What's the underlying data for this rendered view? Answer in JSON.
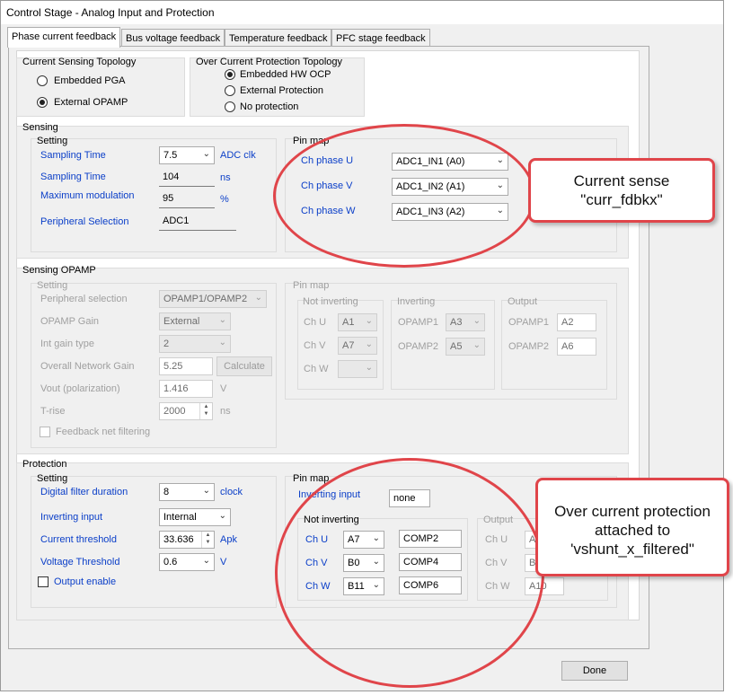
{
  "window": {
    "title": "Control Stage - Analog Input and Protection"
  },
  "tabs": [
    "Phase current feedback",
    "Bus voltage feedback",
    "Temperature feedback",
    "PFC stage feedback"
  ],
  "topology": {
    "label": "Current Sensing Topology",
    "options": [
      "Embedded PGA",
      "External OPAMP"
    ],
    "selected": "External OPAMP"
  },
  "ocp_topology": {
    "label": "Over Current Protection Topology",
    "options": [
      "Embedded HW OCP",
      "External Protection",
      "No protection"
    ],
    "selected": "Embedded HW OCP"
  },
  "sensing": {
    "label": "Sensing",
    "setting_label": "Setting",
    "sampling_time_1": {
      "label": "Sampling Time",
      "value": "7.5",
      "unit": "ADC clk"
    },
    "sampling_time_2": {
      "label": "Sampling Time",
      "value": "104",
      "unit": "ns"
    },
    "max_modulation": {
      "label": "Maximum modulation",
      "value": "95",
      "unit": "%"
    },
    "peripheral": {
      "label": "Peripheral Selection",
      "value": "ADC1"
    },
    "pinmap_label": "Pin map",
    "pins": [
      {
        "label": "Ch phase U",
        "value": "ADC1_IN1 (A0)"
      },
      {
        "label": "Ch phase V",
        "value": "ADC1_IN2 (A1)"
      },
      {
        "label": "Ch phase W",
        "value": "ADC1_IN3 (A2)"
      }
    ]
  },
  "sensing_opamp": {
    "label": "Sensing OPAMP",
    "setting_label": "Setting",
    "peripheral": {
      "label": "Peripheral selection",
      "value": "OPAMP1/OPAMP2"
    },
    "gain": {
      "label": "OPAMP Gain",
      "value": "External"
    },
    "int_gain": {
      "label": "Int gain type",
      "value": "2"
    },
    "network_gain": {
      "label": "Overall Network Gain",
      "value": "5.25",
      "button": "Calculate"
    },
    "vout": {
      "label": "Vout (polarization)",
      "value": "1.416",
      "unit": "V"
    },
    "trise": {
      "label": "T-rise",
      "value": "2000",
      "unit": "ns"
    },
    "feedback_filter": {
      "label": "Feedback net filtering"
    },
    "pinmap_label": "Pin map",
    "not_inverting_label": "Not inverting",
    "ni": [
      {
        "label": "Ch U",
        "value": "A1"
      },
      {
        "label": "Ch V",
        "value": "A7"
      },
      {
        "label": "Ch W",
        "value": ""
      }
    ],
    "inverting_label": "Inverting",
    "inv": [
      {
        "label": "OPAMP1",
        "value": "A3"
      },
      {
        "label": "OPAMP2",
        "value": "A5"
      }
    ],
    "output_label": "Output",
    "out": [
      {
        "label": "OPAMP1",
        "value": "A2"
      },
      {
        "label": "OPAMP2",
        "value": "A6"
      }
    ]
  },
  "protection": {
    "label": "Protection",
    "setting_label": "Setting",
    "filter": {
      "label": "Digital filter duration",
      "value": "8",
      "unit": "clock"
    },
    "inv_input": {
      "label": "Inverting input",
      "value": "Internal"
    },
    "threshold": {
      "label": "Current threshold",
      "value": "33.636",
      "unit": "Apk"
    },
    "vthreshold": {
      "label": "Voltage Threshold",
      "value": "0.6",
      "unit": "V"
    },
    "output_enable": {
      "label": "Output enable"
    },
    "pinmap_label": "Pin map",
    "pm_inv_label": "Inverting input",
    "pm_inv_value": "none",
    "not_inverting_label": "Not inverting",
    "ni": [
      {
        "label": "Ch U",
        "value": "A7",
        "comp": "COMP2"
      },
      {
        "label": "Ch V",
        "value": "B0",
        "comp": "COMP4"
      },
      {
        "label": "Ch W",
        "value": "B11",
        "comp": "COMP6"
      }
    ],
    "output_label": "Output",
    "out": [
      {
        "label": "Ch U",
        "value": "A"
      },
      {
        "label": "Ch V",
        "value": "B"
      },
      {
        "label": "Ch W",
        "value": "A10"
      }
    ]
  },
  "done_label": "Done",
  "annotations": {
    "callout1": [
      "Current sense",
      "\"curr_fdbkx\""
    ],
    "callout2": [
      "Over current protection",
      "attached to",
      "'vshunt_x_filtered\""
    ]
  },
  "colors": {
    "annotation": "#e0454a",
    "link_blue": "#0a3ec8"
  }
}
